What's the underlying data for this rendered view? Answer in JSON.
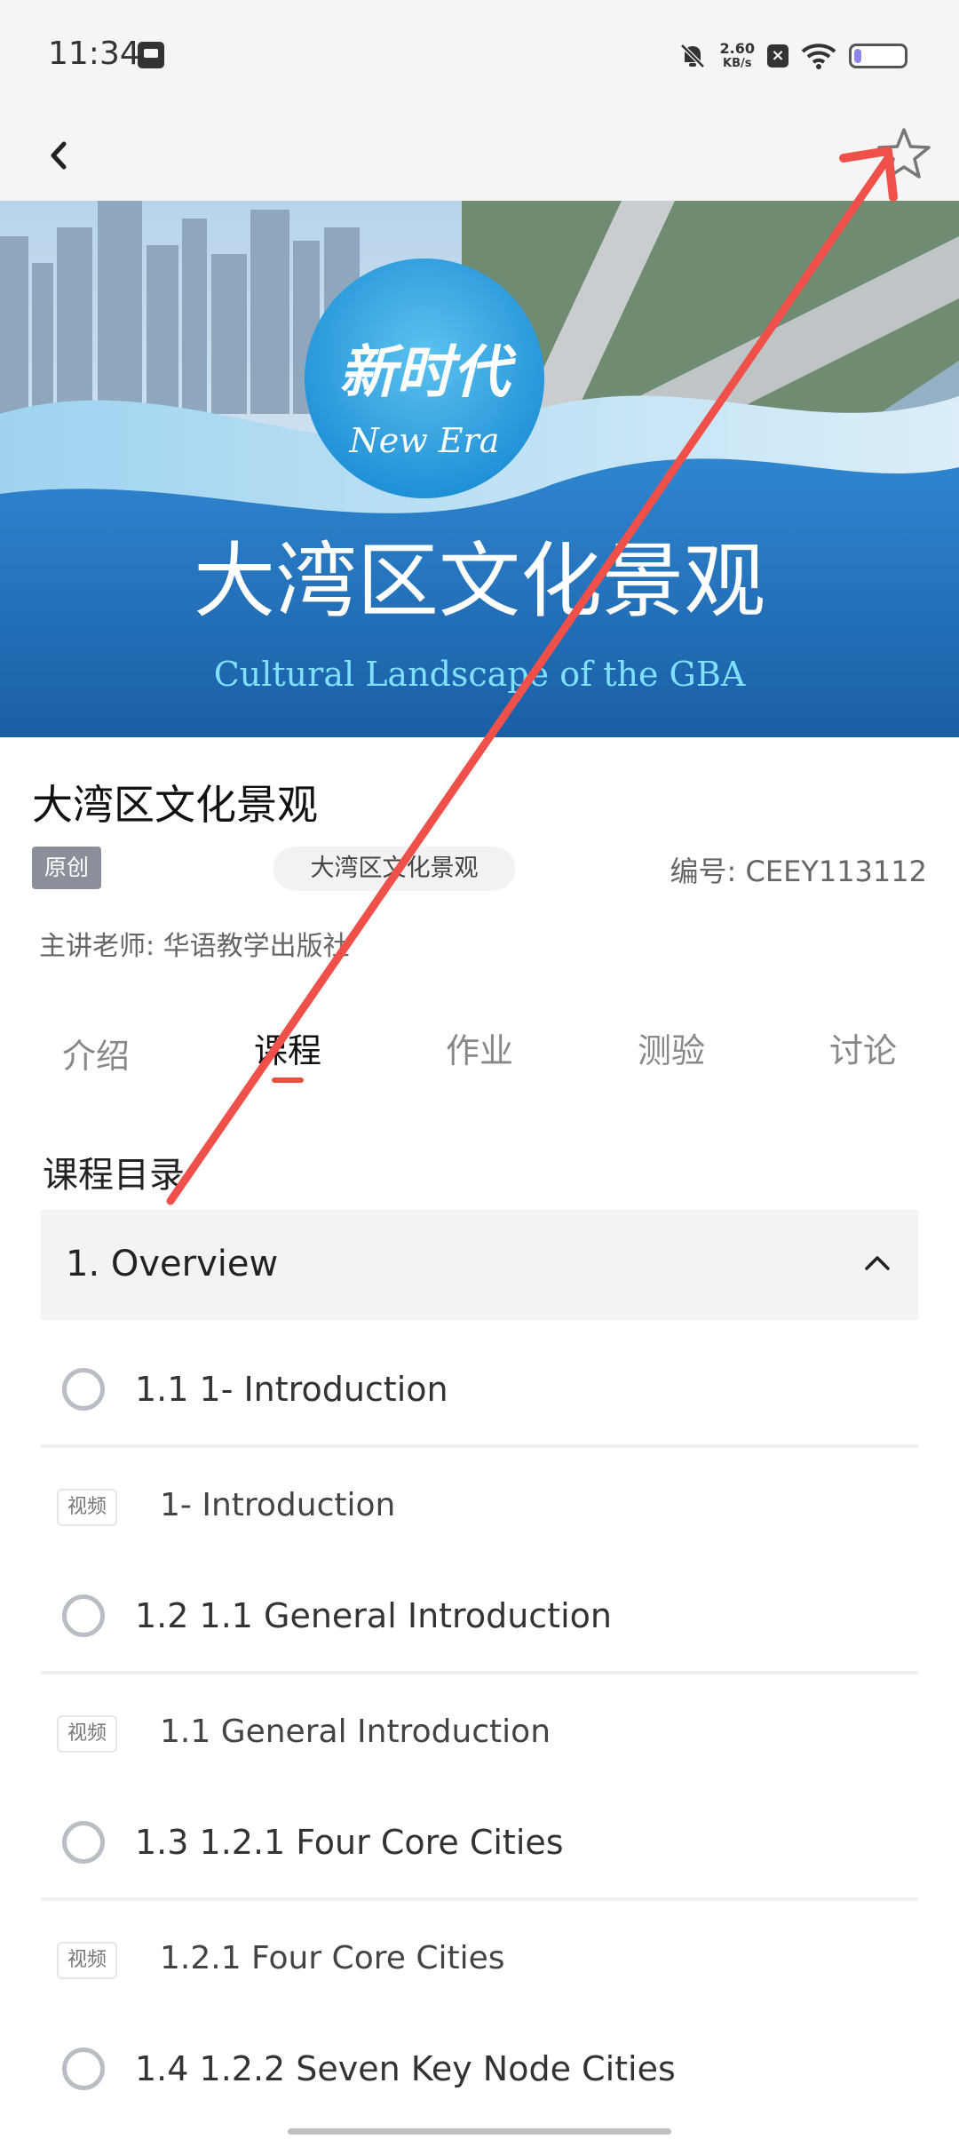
{
  "status_bar": {
    "time": "11:34",
    "net_speed_value": "2.60",
    "net_speed_unit": "KB/s",
    "battery_level": 0.15
  },
  "header": {
    "back_icon": "chevron-left-icon",
    "favorite_icon": "star-outline-icon"
  },
  "banner": {
    "logo_cn": "新时代",
    "logo_en": "New Era",
    "title_cn": "大湾区文化景观",
    "title_en": "Cultural Landscape of the GBA"
  },
  "course": {
    "title": "大湾区文化景观",
    "tag": "原创",
    "topic": "大湾区文化景观",
    "code": "编号: CEEY113112",
    "teacher": "主讲老师: 华语教学出版社"
  },
  "tabs": [
    {
      "label": "介绍",
      "active": false
    },
    {
      "label": "课程",
      "active": true
    },
    {
      "label": "作业",
      "active": false
    },
    {
      "label": "测验",
      "active": false
    },
    {
      "label": "讨论",
      "active": false
    }
  ],
  "catalog": {
    "title": "课程目录",
    "chapter": {
      "title": "1. Overview",
      "expanded": true
    },
    "lessons": [
      {
        "title": "1.1 1- Introduction",
        "video_tag": "视频",
        "video_title": "1- Introduction"
      },
      {
        "title": "1.2 1.1 General Introduction",
        "video_tag": "视频",
        "video_title": "1.1 General Introduction"
      },
      {
        "title": "1.3 1.2.1 Four Core Cities",
        "video_tag": "视频",
        "video_title": "1.2.1 Four Core Cities"
      },
      {
        "title": "1.4 1.2.2 Seven Key Node Cities"
      }
    ]
  },
  "colors": {
    "accent": "#e8533f",
    "annotation": "#f0504a",
    "banner_blue": "#1f6bb3"
  }
}
